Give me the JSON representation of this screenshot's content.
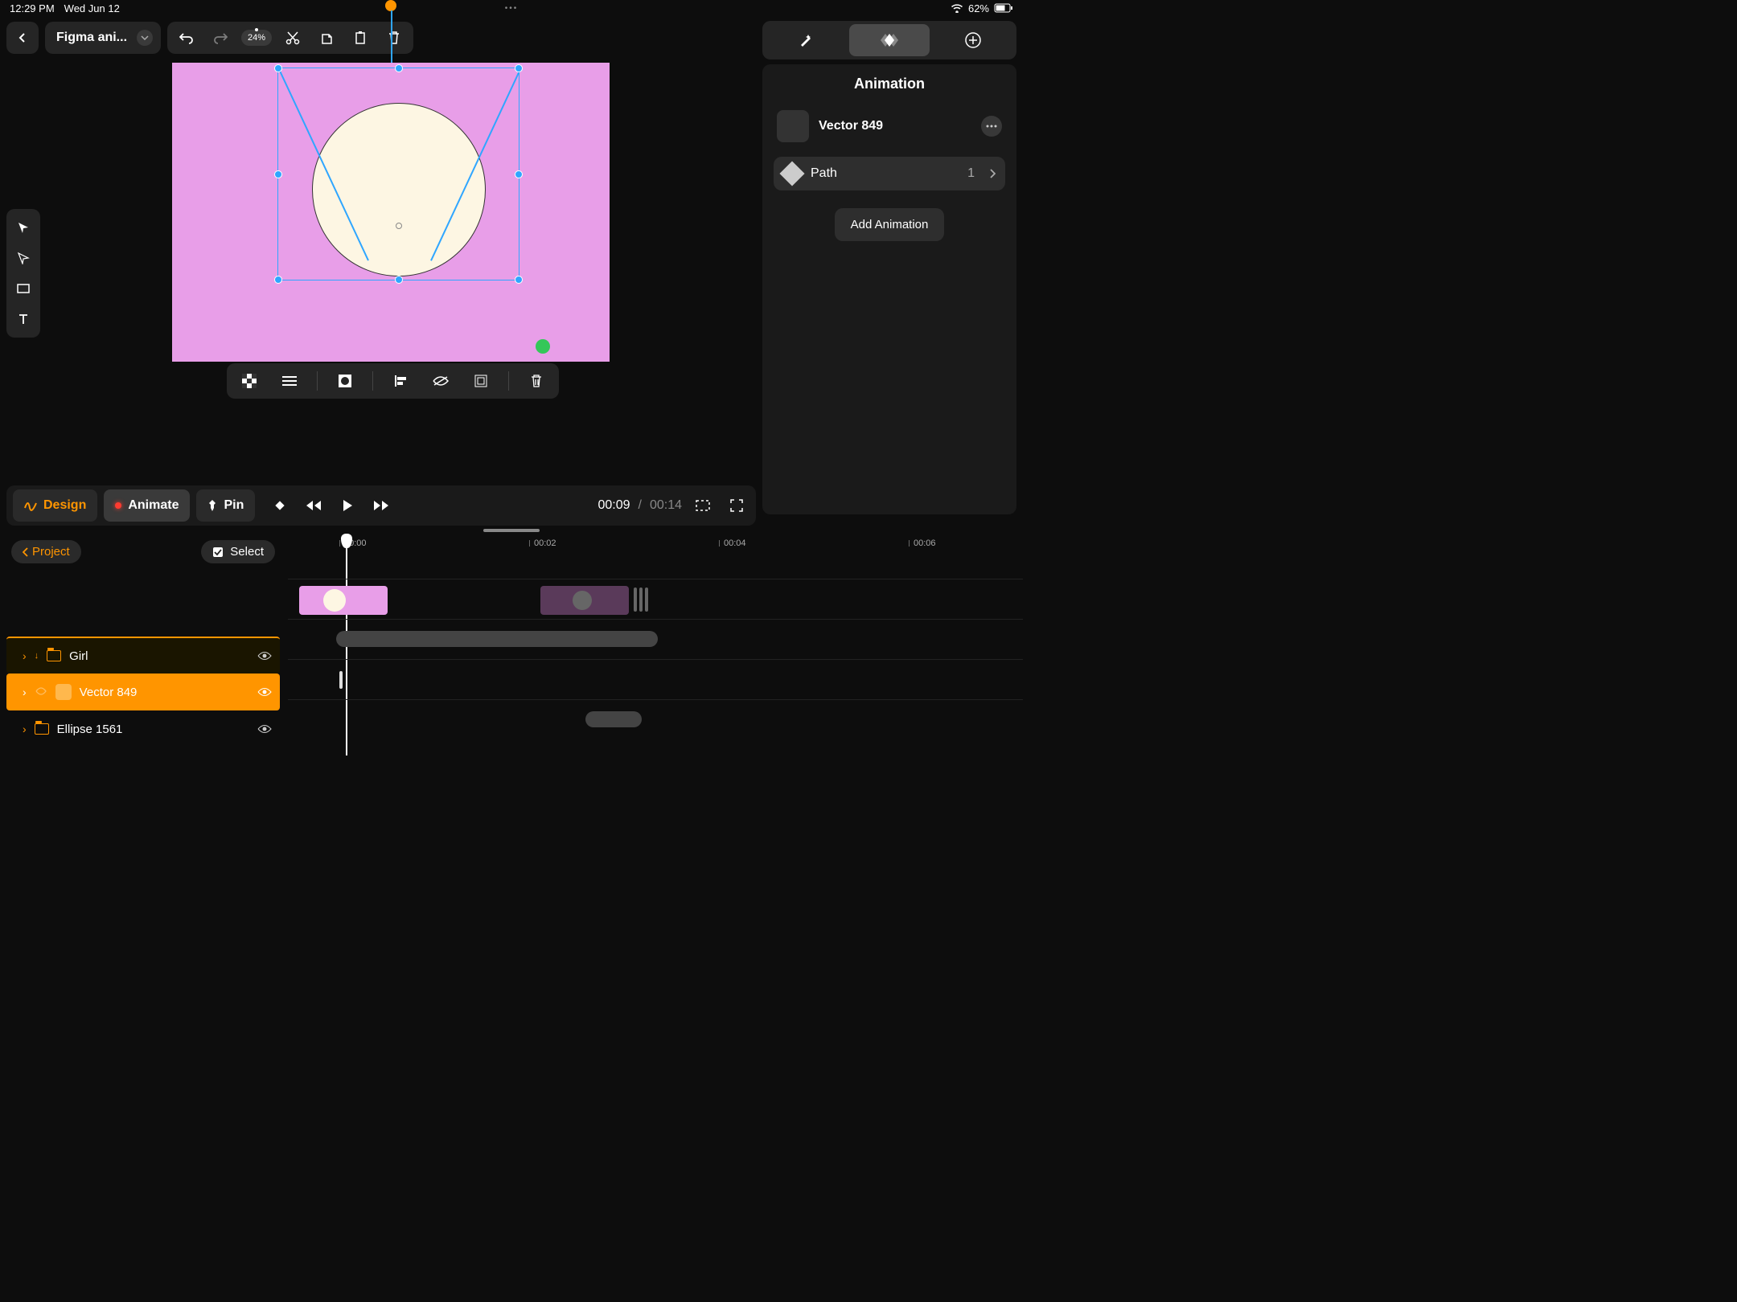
{
  "status": {
    "time": "12:29 PM",
    "date": "Wed Jun 12",
    "battery": "62%"
  },
  "toolbar": {
    "project_name": "Figma ani...",
    "zoom": "24%"
  },
  "right_panel": {
    "title": "Animation",
    "layer_name": "Vector 849",
    "attr_label": "Path",
    "attr_count": "1",
    "add_label": "Add Animation"
  },
  "mode_bar": {
    "design": "Design",
    "animate": "Animate",
    "pin": "Pin",
    "time_current": "00:09",
    "time_total": "00:14"
  },
  "timeline": {
    "back_label": "Project",
    "select_label": "Select",
    "ticks": [
      "00:00",
      "00:02",
      "00:04",
      "00:06"
    ]
  },
  "layers": {
    "girl": "Girl",
    "vector": "Vector 849",
    "ellipse": "Ellipse 1561"
  }
}
